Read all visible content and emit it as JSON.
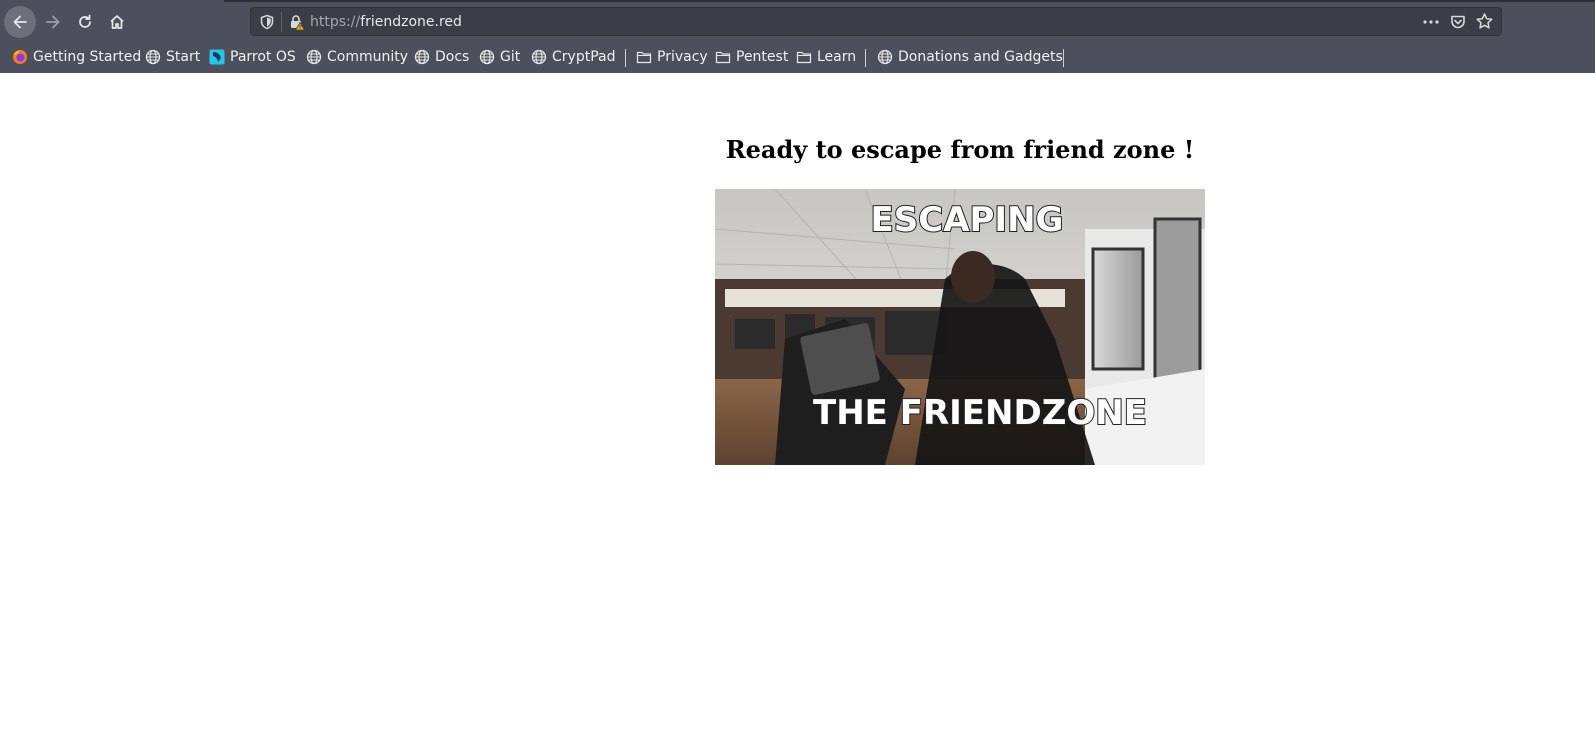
{
  "browser": {
    "url_scheme": "https://",
    "url_host": "friendzone.red",
    "nav": {
      "back_icon": "arrow-left-icon",
      "forward_icon": "arrow-right-icon",
      "reload_icon": "reload-icon",
      "home_icon": "home-icon"
    },
    "urlbar_icons": [
      "shield-icon",
      "insecure-lock-icon",
      "more-icon",
      "pocket-icon",
      "star-icon"
    ]
  },
  "bookmarks": [
    {
      "label": "Getting Started",
      "icon": "firefox-icon"
    },
    {
      "label": "Start",
      "icon": "globe-icon"
    },
    {
      "label": "Parrot OS",
      "icon": "parrot-icon"
    },
    {
      "label": "Community",
      "icon": "globe-icon"
    },
    {
      "label": "Docs",
      "icon": "globe-icon"
    },
    {
      "label": "Git",
      "icon": "globe-icon"
    },
    {
      "label": "CryptPad",
      "icon": "globe-icon"
    },
    {
      "label": "Privacy",
      "icon": "folder-icon"
    },
    {
      "label": "Pentest",
      "icon": "folder-icon"
    },
    {
      "label": "Learn",
      "icon": "folder-icon"
    },
    {
      "label": "Donations and Gadgets",
      "icon": "globe-icon"
    }
  ],
  "page": {
    "heading": "Ready to escape from friend zone !",
    "gif_caption_top": "ESCAPING",
    "gif_caption_bottom": "THE FRIENDZONE"
  },
  "colors": {
    "toolbar": "#4b505c",
    "urlbar": "#3a3e47",
    "page_bg": "#ffffff"
  }
}
